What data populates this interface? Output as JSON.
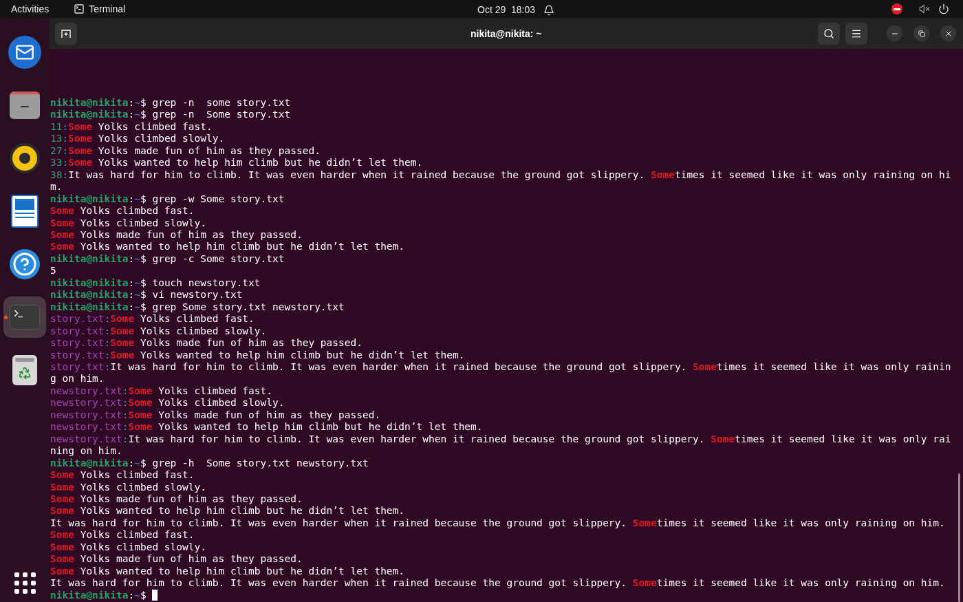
{
  "top_bar": {
    "activities": "Activities",
    "app_name": "Terminal",
    "clock": "Oct 29  18:03"
  },
  "dock": {
    "items": [
      {
        "kind": "mail",
        "active": false
      },
      {
        "kind": "files",
        "active": false
      },
      {
        "kind": "music",
        "active": false
      },
      {
        "kind": "writer",
        "active": false
      },
      {
        "kind": "help",
        "active": false
      },
      {
        "kind": "terminal",
        "active": true
      },
      {
        "kind": "trash",
        "active": false
      }
    ]
  },
  "window": {
    "title": "nikita@nikita: ~"
  },
  "terminal": {
    "lines": [
      {
        "segments": [
          {
            "kind": "user",
            "text": "nikita@nikita"
          },
          {
            "kind": "text",
            "text": ":"
          },
          {
            "kind": "path",
            "text": "~"
          },
          {
            "kind": "text",
            "text": "$ grep -n  some story.txt"
          }
        ]
      },
      {
        "segments": [
          {
            "kind": "user",
            "text": "nikita@nikita"
          },
          {
            "kind": "text",
            "text": ":"
          },
          {
            "kind": "path",
            "text": "~"
          },
          {
            "kind": "text",
            "text": "$ grep -n  Some story.txt"
          }
        ]
      },
      {
        "segments": [
          {
            "kind": "lineno",
            "text": "11"
          },
          {
            "kind": "sep",
            "text": ":"
          },
          {
            "kind": "match",
            "text": "Some"
          },
          {
            "kind": "text",
            "text": " Yolks climbed fast."
          }
        ]
      },
      {
        "segments": [
          {
            "kind": "lineno",
            "text": "13"
          },
          {
            "kind": "sep",
            "text": ":"
          },
          {
            "kind": "match",
            "text": "Some"
          },
          {
            "kind": "text",
            "text": " Yolks climbed slowly."
          }
        ]
      },
      {
        "segments": [
          {
            "kind": "lineno",
            "text": "27"
          },
          {
            "kind": "sep",
            "text": ":"
          },
          {
            "kind": "match",
            "text": "Some"
          },
          {
            "kind": "text",
            "text": " Yolks made fun of him as they passed."
          }
        ]
      },
      {
        "segments": [
          {
            "kind": "lineno",
            "text": "33"
          },
          {
            "kind": "sep",
            "text": ":"
          },
          {
            "kind": "match",
            "text": "Some"
          },
          {
            "kind": "text",
            "text": " Yolks wanted to help him climb but he didn’t let them."
          }
        ]
      },
      {
        "segments": [
          {
            "kind": "lineno",
            "text": "38"
          },
          {
            "kind": "sep",
            "text": ":"
          },
          {
            "kind": "text",
            "text": "It was hard for him to climb. It was even harder when it rained because the ground got slippery. "
          },
          {
            "kind": "match",
            "text": "Some"
          },
          {
            "kind": "text",
            "text": "times it seemed like it was only raining on hi"
          }
        ]
      },
      {
        "segments": [
          {
            "kind": "text",
            "text": "m."
          }
        ]
      },
      {
        "segments": [
          {
            "kind": "user",
            "text": "nikita@nikita"
          },
          {
            "kind": "text",
            "text": ":"
          },
          {
            "kind": "path",
            "text": "~"
          },
          {
            "kind": "text",
            "text": "$ grep -w Some story.txt"
          }
        ]
      },
      {
        "segments": [
          {
            "kind": "match",
            "text": "Some"
          },
          {
            "kind": "text",
            "text": " Yolks climbed fast."
          }
        ]
      },
      {
        "segments": [
          {
            "kind": "match",
            "text": "Some"
          },
          {
            "kind": "text",
            "text": " Yolks climbed slowly."
          }
        ]
      },
      {
        "segments": [
          {
            "kind": "match",
            "text": "Some"
          },
          {
            "kind": "text",
            "text": " Yolks made fun of him as they passed."
          }
        ]
      },
      {
        "segments": [
          {
            "kind": "match",
            "text": "Some"
          },
          {
            "kind": "text",
            "text": " Yolks wanted to help him climb but he didn’t let them."
          }
        ]
      },
      {
        "segments": [
          {
            "kind": "user",
            "text": "nikita@nikita"
          },
          {
            "kind": "text",
            "text": ":"
          },
          {
            "kind": "path",
            "text": "~"
          },
          {
            "kind": "text",
            "text": "$ grep -c Some story.txt"
          }
        ]
      },
      {
        "segments": [
          {
            "kind": "text",
            "text": "5"
          }
        ]
      },
      {
        "segments": [
          {
            "kind": "user",
            "text": "nikita@nikita"
          },
          {
            "kind": "text",
            "text": ":"
          },
          {
            "kind": "path",
            "text": "~"
          },
          {
            "kind": "text",
            "text": "$ touch newstory.txt"
          }
        ]
      },
      {
        "segments": [
          {
            "kind": "user",
            "text": "nikita@nikita"
          },
          {
            "kind": "text",
            "text": ":"
          },
          {
            "kind": "path",
            "text": "~"
          },
          {
            "kind": "text",
            "text": "$ vi newstory.txt"
          }
        ]
      },
      {
        "segments": [
          {
            "kind": "user",
            "text": "nikita@nikita"
          },
          {
            "kind": "text",
            "text": ":"
          },
          {
            "kind": "path",
            "text": "~"
          },
          {
            "kind": "text",
            "text": "$ grep Some story.txt newstory.txt"
          }
        ]
      },
      {
        "segments": [
          {
            "kind": "file",
            "text": "story.txt"
          },
          {
            "kind": "sep",
            "text": ":"
          },
          {
            "kind": "match",
            "text": "Some"
          },
          {
            "kind": "text",
            "text": " Yolks climbed fast."
          }
        ]
      },
      {
        "segments": [
          {
            "kind": "file",
            "text": "story.txt"
          },
          {
            "kind": "sep",
            "text": ":"
          },
          {
            "kind": "match",
            "text": "Some"
          },
          {
            "kind": "text",
            "text": " Yolks climbed slowly."
          }
        ]
      },
      {
        "segments": [
          {
            "kind": "file",
            "text": "story.txt"
          },
          {
            "kind": "sep",
            "text": ":"
          },
          {
            "kind": "match",
            "text": "Some"
          },
          {
            "kind": "text",
            "text": " Yolks made fun of him as they passed."
          }
        ]
      },
      {
        "segments": [
          {
            "kind": "file",
            "text": "story.txt"
          },
          {
            "kind": "sep",
            "text": ":"
          },
          {
            "kind": "match",
            "text": "Some"
          },
          {
            "kind": "text",
            "text": " Yolks wanted to help him climb but he didn’t let them."
          }
        ]
      },
      {
        "segments": [
          {
            "kind": "file",
            "text": "story.txt"
          },
          {
            "kind": "sep",
            "text": ":"
          },
          {
            "kind": "text",
            "text": "It was hard for him to climb. It was even harder when it rained because the ground got slippery. "
          },
          {
            "kind": "match",
            "text": "Some"
          },
          {
            "kind": "text",
            "text": "times it seemed like it was only rainin"
          }
        ]
      },
      {
        "segments": [
          {
            "kind": "text",
            "text": "g on him."
          }
        ]
      },
      {
        "segments": [
          {
            "kind": "file",
            "text": "newstory.txt"
          },
          {
            "kind": "sep",
            "text": ":"
          },
          {
            "kind": "match",
            "text": "Some"
          },
          {
            "kind": "text",
            "text": " Yolks climbed fast."
          }
        ]
      },
      {
        "segments": [
          {
            "kind": "file",
            "text": "newstory.txt"
          },
          {
            "kind": "sep",
            "text": ":"
          },
          {
            "kind": "match",
            "text": "Some"
          },
          {
            "kind": "text",
            "text": " Yolks climbed slowly."
          }
        ]
      },
      {
        "segments": [
          {
            "kind": "file",
            "text": "newstory.txt"
          },
          {
            "kind": "sep",
            "text": ":"
          },
          {
            "kind": "match",
            "text": "Some"
          },
          {
            "kind": "text",
            "text": " Yolks made fun of him as they passed."
          }
        ]
      },
      {
        "segments": [
          {
            "kind": "file",
            "text": "newstory.txt"
          },
          {
            "kind": "sep",
            "text": ":"
          },
          {
            "kind": "match",
            "text": "Some"
          },
          {
            "kind": "text",
            "text": " Yolks wanted to help him climb but he didn’t let them."
          }
        ]
      },
      {
        "segments": [
          {
            "kind": "file",
            "text": "newstory.txt"
          },
          {
            "kind": "sep",
            "text": ":"
          },
          {
            "kind": "text",
            "text": "It was hard for him to climb. It was even harder when it rained because the ground got slippery. "
          },
          {
            "kind": "match",
            "text": "Some"
          },
          {
            "kind": "text",
            "text": "times it seemed like it was only rai"
          }
        ]
      },
      {
        "segments": [
          {
            "kind": "text",
            "text": "ning on him."
          }
        ]
      },
      {
        "segments": [
          {
            "kind": "user",
            "text": "nikita@nikita"
          },
          {
            "kind": "text",
            "text": ":"
          },
          {
            "kind": "path",
            "text": "~"
          },
          {
            "kind": "text",
            "text": "$ grep -h  Some story.txt newstory.txt"
          }
        ]
      },
      {
        "segments": [
          {
            "kind": "match",
            "text": "Some"
          },
          {
            "kind": "text",
            "text": " Yolks climbed fast."
          }
        ]
      },
      {
        "segments": [
          {
            "kind": "match",
            "text": "Some"
          },
          {
            "kind": "text",
            "text": " Yolks climbed slowly."
          }
        ]
      },
      {
        "segments": [
          {
            "kind": "match",
            "text": "Some"
          },
          {
            "kind": "text",
            "text": " Yolks made fun of him as they passed."
          }
        ]
      },
      {
        "segments": [
          {
            "kind": "match",
            "text": "Some"
          },
          {
            "kind": "text",
            "text": " Yolks wanted to help him climb but he didn’t let them."
          }
        ]
      },
      {
        "segments": [
          {
            "kind": "text",
            "text": "It was hard for him to climb. It was even harder when it rained because the ground got slippery. "
          },
          {
            "kind": "match",
            "text": "Some"
          },
          {
            "kind": "text",
            "text": "times it seemed like it was only raining on him."
          }
        ]
      },
      {
        "segments": [
          {
            "kind": "match",
            "text": "Some"
          },
          {
            "kind": "text",
            "text": " Yolks climbed fast."
          }
        ]
      },
      {
        "segments": [
          {
            "kind": "match",
            "text": "Some"
          },
          {
            "kind": "text",
            "text": " Yolks climbed slowly."
          }
        ]
      },
      {
        "segments": [
          {
            "kind": "match",
            "text": "Some"
          },
          {
            "kind": "text",
            "text": " Yolks made fun of him as they passed."
          }
        ]
      },
      {
        "segments": [
          {
            "kind": "match",
            "text": "Some"
          },
          {
            "kind": "text",
            "text": " Yolks wanted to help him climb but he didn’t let them."
          }
        ]
      },
      {
        "segments": [
          {
            "kind": "text",
            "text": "It was hard for him to climb. It was even harder when it rained because the ground got slippery. "
          },
          {
            "kind": "match",
            "text": "Some"
          },
          {
            "kind": "text",
            "text": "times it seemed like it was only raining on him."
          }
        ]
      },
      {
        "segments": [
          {
            "kind": "user",
            "text": "nikita@nikita"
          },
          {
            "kind": "text",
            "text": ":"
          },
          {
            "kind": "path",
            "text": "~"
          },
          {
            "kind": "text",
            "text": "$ "
          }
        ],
        "cursor": true
      }
    ]
  }
}
